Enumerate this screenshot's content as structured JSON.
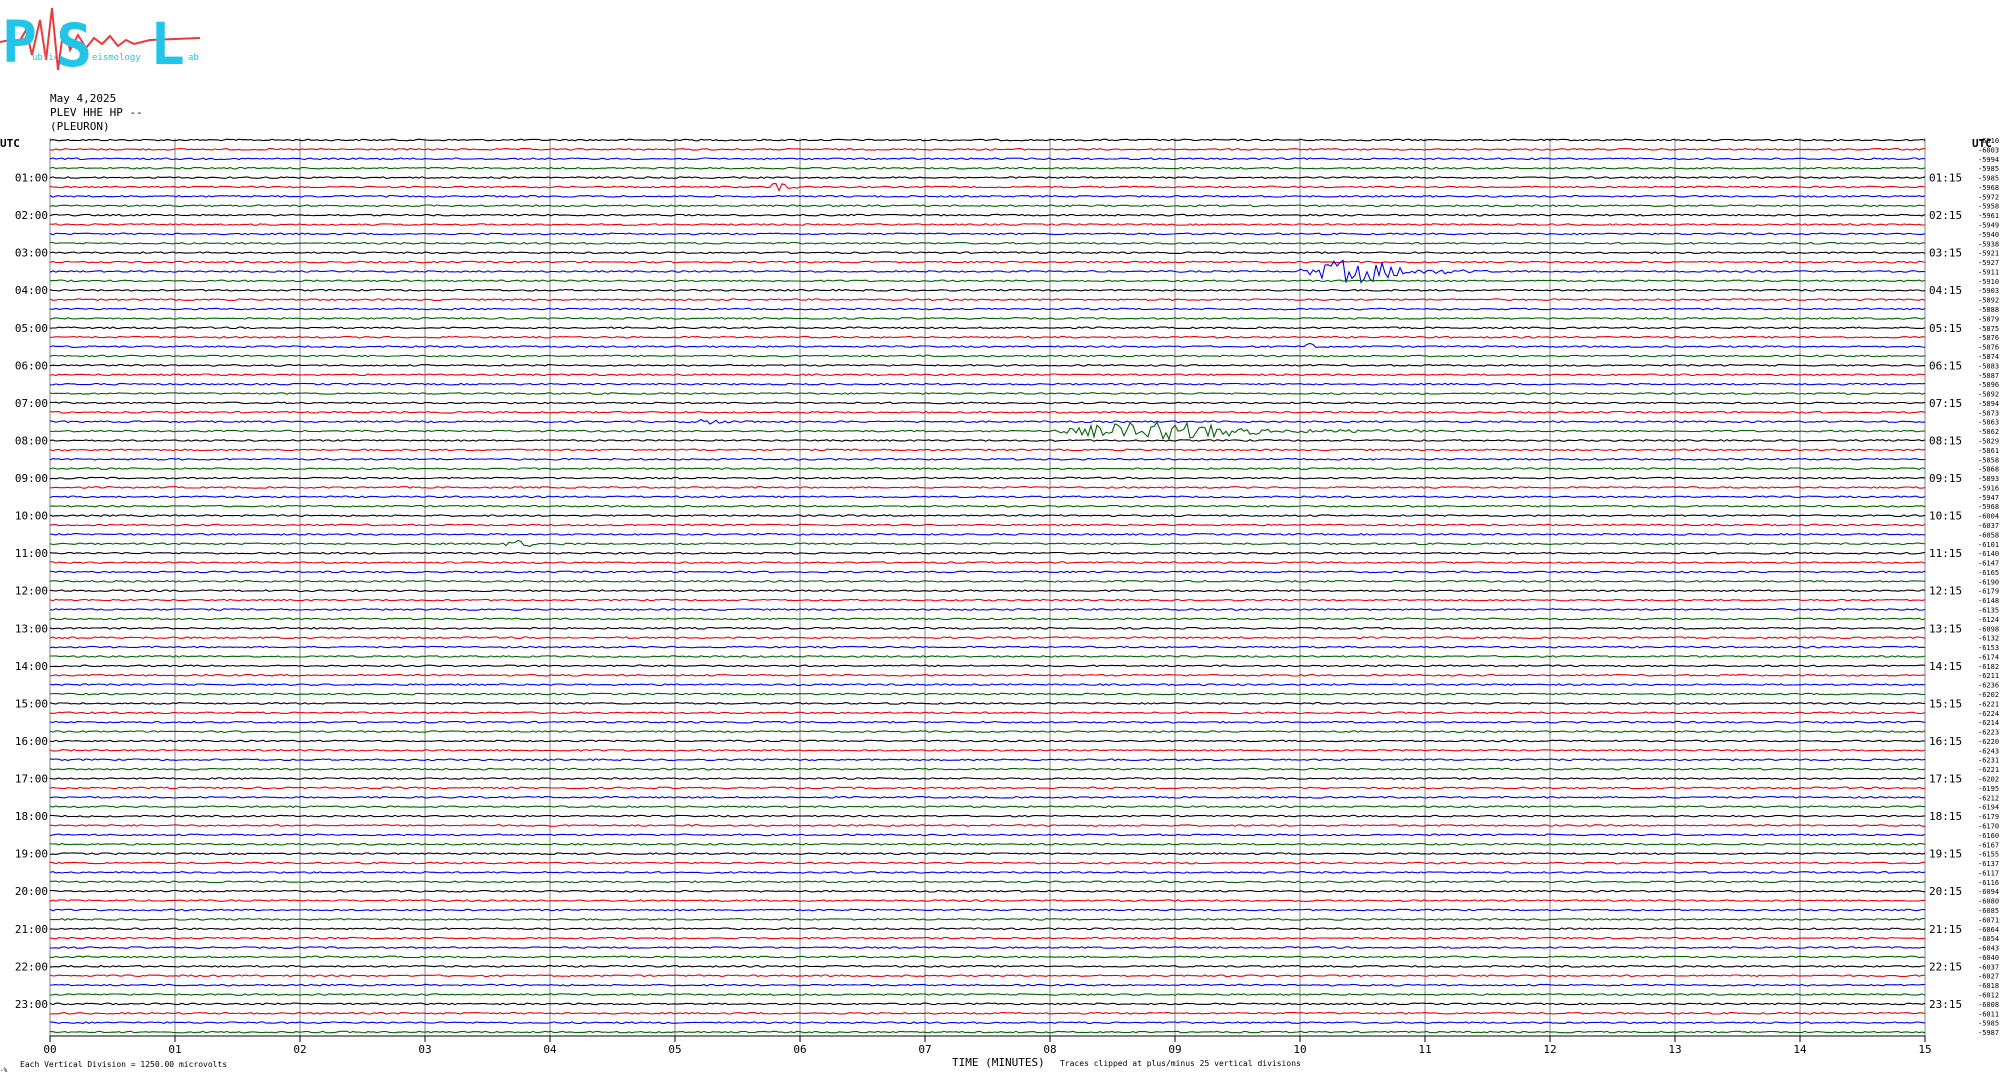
{
  "logo": {
    "letters": [
      "P",
      "S",
      "L"
    ],
    "small_text": [
      "ublic",
      "eismology",
      "ab"
    ]
  },
  "header": {
    "date": "May 4,2025",
    "station": "PLEV HHE HP --",
    "location": "(PLEURON)"
  },
  "footer": {
    "scale_note": "Each Vertical Division = 1250.00 microvolts",
    "xlabel": "TIME (MINUTES)",
    "clip_note": "Traces clipped at plus/minus 25 vertical divisions",
    "corner_mark": "-%"
  },
  "chart_data": {
    "type": "line",
    "title": "",
    "xlabel": "TIME (MINUTES)",
    "ylabel": "UTC",
    "right_axis_label": "UTC",
    "x_ticks": [
      "00",
      "01",
      "02",
      "03",
      "04",
      "05",
      "06",
      "07",
      "08",
      "09",
      "10",
      "11",
      "12",
      "13",
      "14",
      "15"
    ],
    "xlim": [
      0,
      15
    ],
    "rows_per_hour": 4,
    "row_minutes": 15,
    "left_hour_labels": [
      "01:00",
      "02:00",
      "03:00",
      "04:00",
      "05:00",
      "06:00",
      "07:00",
      "08:00",
      "09:00",
      "10:00",
      "11:00",
      "12:00",
      "13:00",
      "14:00",
      "15:00",
      "16:00",
      "17:00",
      "18:00",
      "19:00",
      "20:00",
      "21:00",
      "22:00",
      "23:00"
    ],
    "right_hour_labels": [
      "01:15",
      "02:15",
      "03:15",
      "04:15",
      "05:15",
      "06:15",
      "07:15",
      "08:15",
      "09:15",
      "10:15",
      "11:15",
      "12:15",
      "13:15",
      "14:15",
      "15:15",
      "16:15",
      "17:15",
      "18:15",
      "19:15",
      "20:15",
      "21:15",
      "22:15",
      "23:15"
    ],
    "trace_colors": [
      "#000000",
      "#e8000b",
      "#0000ee",
      "#006400"
    ],
    "row_offsets": [
      "-6010",
      "-6003",
      "-5994",
      "-5985",
      "-5985",
      "-5968",
      "-5972",
      "-5958",
      "-5961",
      "-5949",
      "-5940",
      "-5938",
      "-5921",
      "-5927",
      "-5911",
      "-5910",
      "-5903",
      "-5892",
      "-5888",
      "-5879",
      "-5875",
      "-5876",
      "-5876",
      "-5874",
      "-5883",
      "-5887",
      "-5896",
      "-5892",
      "-5894",
      "-5873",
      "-5863",
      "-5862",
      "-5829",
      "-5861",
      "-5858",
      "-5868",
      "-5893",
      "-5916",
      "-5947",
      "-5968",
      "-6004",
      "-6037",
      "-6058",
      "-6101",
      "-6140",
      "-6147",
      "-6165",
      "-6190",
      "-6179",
      "-6148",
      "-6135",
      "-6124",
      "-6098",
      "-6132",
      "-6153",
      "-6174",
      "-6182",
      "-6211",
      "-6236",
      "-6202",
      "-6221",
      "-6224",
      "-6214",
      "-6223",
      "-6220",
      "-6243",
      "-6231",
      "-6221",
      "-6202",
      "-6195",
      "-6212",
      "-6194",
      "-6179",
      "-6170",
      "-6160",
      "-6167",
      "-6155",
      "-6137",
      "-6117",
      "-6116",
      "-6094",
      "-6080",
      "-6085",
      "-6071",
      "-6064",
      "-6054",
      "-6043",
      "-6040",
      "-6037",
      "-6027",
      "-6018",
      "-6012",
      "-6008",
      "-6011",
      "-5985",
      "-5987"
    ],
    "events": [
      {
        "row": 5,
        "start_min": 5.75,
        "end_min": 6.0,
        "amplitude": 9
      },
      {
        "row": 14,
        "start_min": 10.0,
        "end_min": 11.5,
        "amplitude": 14
      },
      {
        "row": 22,
        "start_min": 10.05,
        "end_min": 10.15,
        "amplitude": 8
      },
      {
        "row": 30,
        "start_min": 5.1,
        "end_min": 5.7,
        "amplitude": 3
      },
      {
        "row": 31,
        "start_min": 8.0,
        "end_min": 11.0,
        "amplitude": 10
      },
      {
        "row": 43,
        "start_min": 3.6,
        "end_min": 4.2,
        "amplitude": 4
      }
    ]
  }
}
